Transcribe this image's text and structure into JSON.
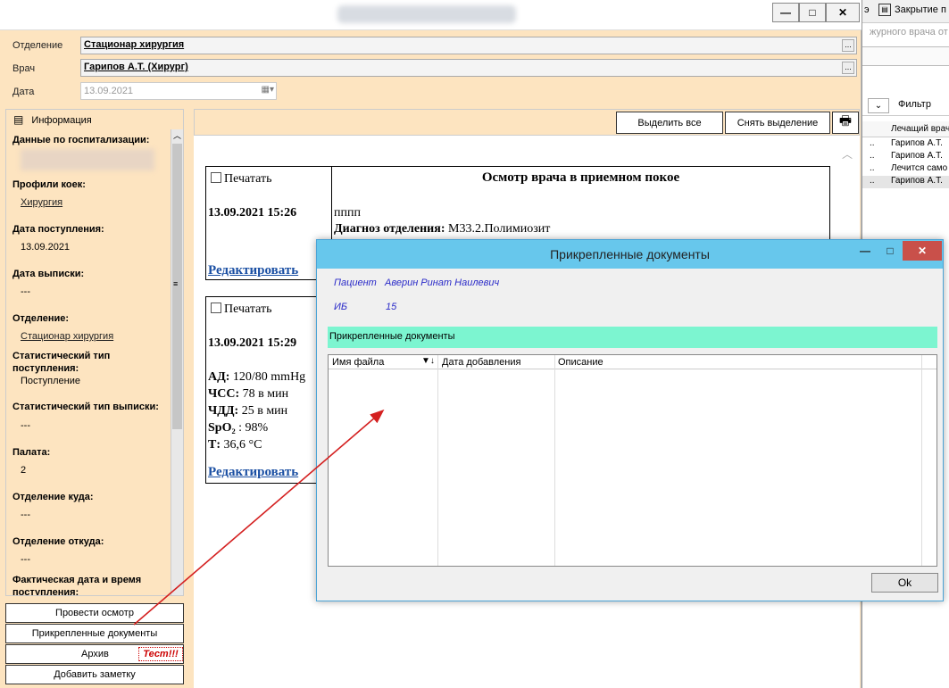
{
  "background_app": {
    "toolbar_icon_text": "э",
    "toolbar_label": "Закрытие п",
    "hint_text": "журного врача от",
    "filter_label": "Фильтр",
    "column_header": "Лечащий врач",
    "rows": [
      {
        "dots": "..",
        "text": "Гарипов А.Т."
      },
      {
        "dots": "..",
        "text": "Гарипов А.Т."
      },
      {
        "dots": "..",
        "text": "Лечится само"
      },
      {
        "dots": "..",
        "text": "Гарипов А.Т."
      }
    ]
  },
  "main_window": {
    "controls": {
      "minimize": "—",
      "maximize": "□",
      "close": "✕"
    },
    "department_label": "Отделение",
    "department_value": "Стационар хирургия",
    "doctor_label": "Врач",
    "doctor_value": "Гарипов А.Т. (Хирург)",
    "date_label": "Дата",
    "date_value": "13.09.2021",
    "ellipsis": "..."
  },
  "info_panel": {
    "header": "Информация",
    "sections": [
      {
        "title": "Данные по госпитализации:",
        "value": ""
      },
      {
        "title": "Профили коек:",
        "value": "Хирургия",
        "link": true
      },
      {
        "title": "Дата поступления:",
        "value": "13.09.2021"
      },
      {
        "title": "Дата выписки:",
        "value": "---"
      },
      {
        "title": "Отделение:",
        "value": "Стационар хирургия",
        "link": true
      },
      {
        "title": "Статистический тип поступления:",
        "value": "Поступление"
      },
      {
        "title": "Статистический тип выписки:",
        "value": "---"
      },
      {
        "title": "Палата:",
        "value": "2"
      },
      {
        "title": "Отделение куда:",
        "value": "---"
      },
      {
        "title": "Отделение откуда:",
        "value": "---"
      },
      {
        "title": "Фактическая дата и время поступления:",
        "value": ""
      }
    ]
  },
  "side_buttons": {
    "exam": "Провести осмотр",
    "attached": "Прикрепленные документы",
    "archive": "Архив",
    "test": "Тест!!!",
    "add_note": "Добавить заметку"
  },
  "content_toolbar": {
    "select_all": "Выделить все",
    "deselect": "Снять выделение"
  },
  "cards": [
    {
      "print_label": "Печатать",
      "datetime": "13.09.2021 15:26",
      "edit_link": "Редактировать",
      "title": "Осмотр врача в приемном покое",
      "text": "пппп",
      "diagnosis_label": "Диагноз отделения:",
      "diagnosis_value": "М33.2.Полимиозит"
    },
    {
      "print_label": "Печатать",
      "datetime": "13.09.2021 15:29",
      "edit_link": "Редактировать",
      "vitals": [
        {
          "label": "АД:",
          "value": "120/80 mmHg"
        },
        {
          "label": "ЧСС:",
          "value": "78 в мин"
        },
        {
          "label": "ЧДД:",
          "value": "25 в мин"
        },
        {
          "label": "SpO₂",
          "value": ": 98%"
        },
        {
          "label": "Т:",
          "value": "36,6 °С"
        }
      ]
    }
  ],
  "dialog": {
    "title": "Прикрепленные документы",
    "controls": {
      "minimize": "—",
      "maximize": "□",
      "close": "✕"
    },
    "patient_label": "Пациент",
    "patient_value": "Аверин Ринат Наилевич",
    "ib_label": "ИБ",
    "ib_value": "15",
    "section_title": "Прикрепленные документы",
    "columns": [
      "Имя файла",
      "Дата добавления",
      "Описание"
    ],
    "ok_label": "Ok"
  },
  "colors": {
    "panel_bg": "#fde4c0",
    "dialog_title_bg": "#67c7ec",
    "section_bg": "#7cf5d0",
    "link_blue": "#1a4fa3",
    "annotation_arrow": "#d42020",
    "test_red": "#cc0000"
  }
}
